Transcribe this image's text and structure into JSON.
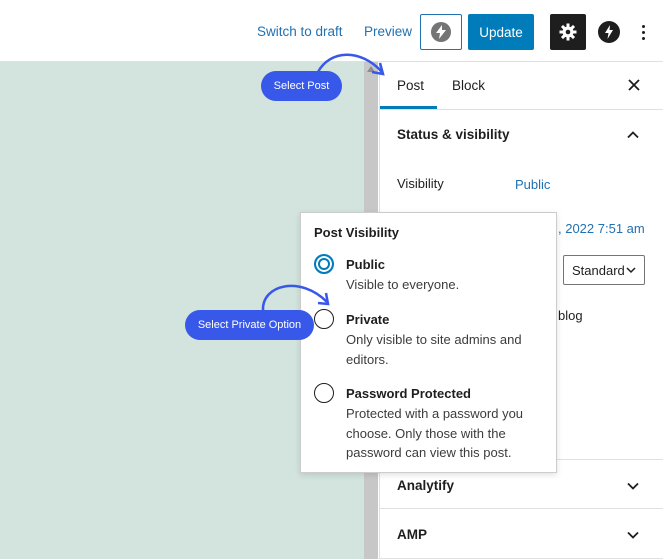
{
  "toolbar": {
    "switch_to_draft": "Switch to draft",
    "preview": "Preview",
    "update": "Update"
  },
  "sidebar": {
    "tabs": [
      {
        "label": "Post",
        "active": true
      },
      {
        "label": "Block",
        "active": false
      }
    ],
    "status_panel": {
      "title": "Status & visibility",
      "visibility_label": "Visibility",
      "visibility_value": "Public",
      "publish_partial": ", 2022 7:51 am",
      "format_value": "Standard",
      "partial_text": "blog"
    },
    "panels": [
      {
        "title": "Analytify"
      },
      {
        "title": "AMP"
      }
    ]
  },
  "popover": {
    "title": "Post Visibility",
    "options": [
      {
        "label": "Public",
        "description": "Visible to everyone.",
        "selected": true
      },
      {
        "label": "Private",
        "description": "Only visible to site admins and editors.",
        "selected": false
      },
      {
        "label": "Password Protected",
        "description": "Protected with a password you choose. Only those with the password can view this post.",
        "selected": false
      }
    ]
  },
  "annotations": {
    "select_post": "Select Post",
    "select_private": "Select Private Option"
  },
  "colors": {
    "accent": "#007cba",
    "link": "#2271b1",
    "canvas": "#d2e4dd",
    "callout": "#3858e9"
  },
  "icons": [
    "lightning-icon",
    "gear-icon",
    "amp-bolt-icon",
    "more-vertical-icon",
    "close-icon",
    "chevron-up-icon",
    "chevron-down-icon"
  ]
}
